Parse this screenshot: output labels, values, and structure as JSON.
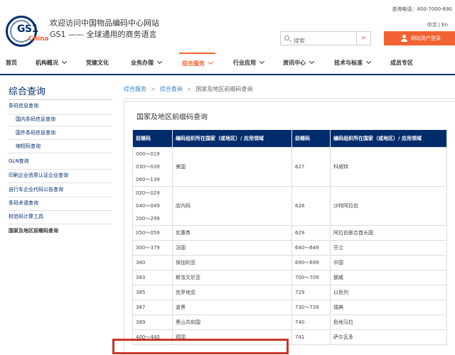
{
  "header": {
    "logo_text": "GS1",
    "logo_china": "China",
    "welcome": "欢迎访问中国物品编码中心网站",
    "slogan": "GS1 —— 全球通用的商务语言",
    "phone": "咨询电话：400-7000-690",
    "lang": [
      "中文",
      "En"
    ],
    "search_placeholder": "搜索",
    "search_button": ">",
    "login_label": "网站用户登录"
  },
  "nav": [
    {
      "label": "首页",
      "chevron": false
    },
    {
      "label": "机构概况",
      "chevron": true
    },
    {
      "label": "党建文化",
      "chevron": false
    },
    {
      "label": "业务办理",
      "chevron": true
    },
    {
      "label": "综合服务",
      "chevron": true,
      "active": true
    },
    {
      "label": "行业应用",
      "chevron": true
    },
    {
      "label": "资讯中心",
      "chevron": true
    },
    {
      "label": "技术与标准",
      "chevron": true
    },
    {
      "label": "成员专区",
      "chevron": false
    }
  ],
  "sidebar": {
    "title": "综合查询",
    "items": [
      {
        "label": "条码信息查询",
        "sub": false
      },
      {
        "label": "国内条码信息查询",
        "sub": true
      },
      {
        "label": "国外条码信息查询",
        "sub": true
      },
      {
        "label": "缩短码查询",
        "sub": true
      },
      {
        "label": "GLN查询",
        "sub": false
      },
      {
        "label": "印刷企业资质认证企业查询",
        "sub": false
      },
      {
        "label": "自行车企业代码公告查询",
        "sub": false
      },
      {
        "label": "条码术语查询",
        "sub": false
      },
      {
        "label": "校验码计算工具",
        "sub": false
      },
      {
        "label": "国家及地区前缀码查询",
        "sub": false,
        "current": true
      }
    ]
  },
  "breadcrumb": [
    "综合服务",
    "综合查询",
    "国家及地区前缀码查询"
  ],
  "main": {
    "title": "国家及地区前缀码查询",
    "table": {
      "headers": [
        "前缀码",
        "编码组织所在国家（或地区）/ 应用领域",
        "前缀码",
        "编码组织所在国家（或地区）/ 应用领域"
      ],
      "rows": [
        [
          [
            "000～019",
            "030～039",
            "060～139"
          ],
          "美国",
          "627",
          "科威特"
        ],
        [
          [
            "020～029",
            "040～049",
            "200～299"
          ],
          "店内码",
          "628",
          "沙特阿拉伯"
        ],
        [
          [
            "050～059"
          ],
          "优惠券",
          "629",
          "阿拉伯联合酋长国"
        ],
        [
          [
            "300～379"
          ],
          "法国",
          "640～649",
          "芬兰"
        ],
        [
          [
            "380"
          ],
          "保加利亚",
          "690～699",
          "中国"
        ],
        [
          [
            "383"
          ],
          "斯洛文尼亚",
          "700～709",
          "挪威"
        ],
        [
          [
            "385"
          ],
          "克罗地亚",
          "729",
          "以色列"
        ],
        [
          [
            "387"
          ],
          "波黑",
          "730～739",
          "瑞典"
        ],
        [
          [
            "389"
          ],
          "黑山共和国",
          "740",
          "危地马拉"
        ],
        [
          [
            "400～440"
          ],
          "德国",
          "741",
          "萨尔瓦多"
        ]
      ]
    }
  },
  "colors": {
    "brand_navy": "#002c6c",
    "accent_orange": "#f26334",
    "highlight_red": "#c9352a"
  }
}
